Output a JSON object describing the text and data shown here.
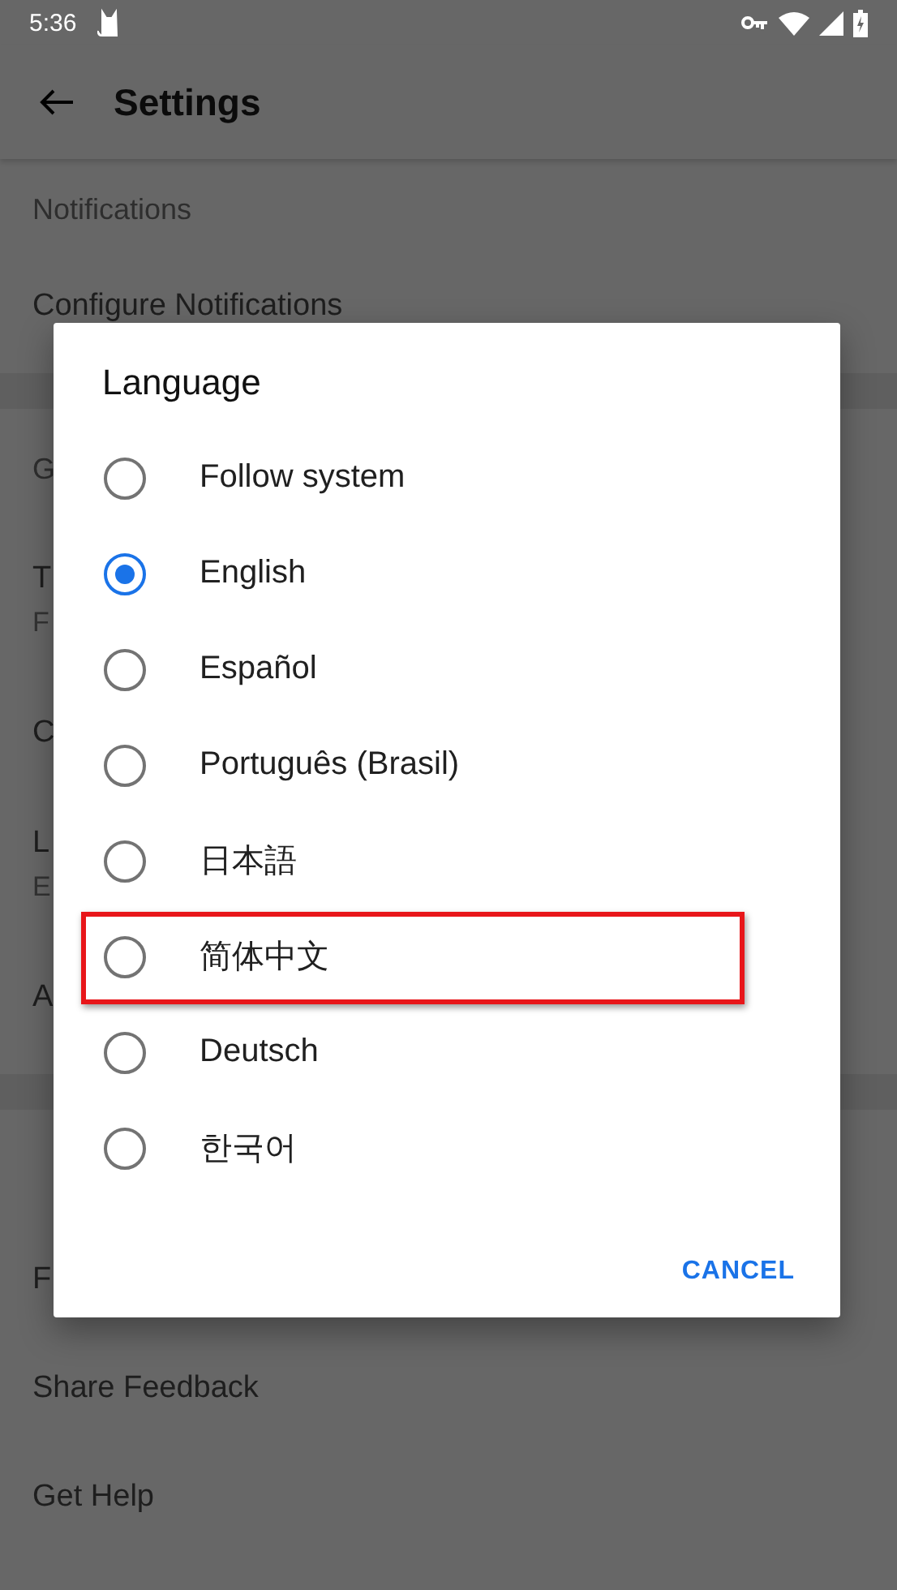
{
  "status_bar": {
    "time": "5:36"
  },
  "app_bar": {
    "title": "Settings"
  },
  "settings_list": [
    {
      "kind": "header",
      "title": "Notifications"
    },
    {
      "kind": "item",
      "title": "Configure Notifications"
    },
    {
      "kind": "divider"
    },
    {
      "kind": "header",
      "title": "G"
    },
    {
      "kind": "item",
      "title": "T",
      "subtitle": "F"
    },
    {
      "kind": "item",
      "title": "C"
    },
    {
      "kind": "item",
      "title": "L",
      "subtitle": "E"
    },
    {
      "kind": "item",
      "title": "A"
    },
    {
      "kind": "divider"
    },
    {
      "kind": "blank"
    },
    {
      "kind": "item",
      "title": "F"
    },
    {
      "kind": "item",
      "title": "Share Feedback"
    },
    {
      "kind": "item",
      "title": "Get Help"
    }
  ],
  "dialog": {
    "title": "Language",
    "options": [
      {
        "label": "Follow system",
        "selected": false,
        "highlighted": false
      },
      {
        "label": "English",
        "selected": true,
        "highlighted": false
      },
      {
        "label": "Español",
        "selected": false,
        "highlighted": false
      },
      {
        "label": "Português (Brasil)",
        "selected": false,
        "highlighted": false
      },
      {
        "label": "日本語",
        "selected": false,
        "highlighted": false
      },
      {
        "label": "简体中文",
        "selected": false,
        "highlighted": true
      },
      {
        "label": "Deutsch",
        "selected": false,
        "highlighted": false
      },
      {
        "label": "한국어",
        "selected": false,
        "highlighted": false
      }
    ],
    "buttons": [
      "CANCEL"
    ]
  }
}
